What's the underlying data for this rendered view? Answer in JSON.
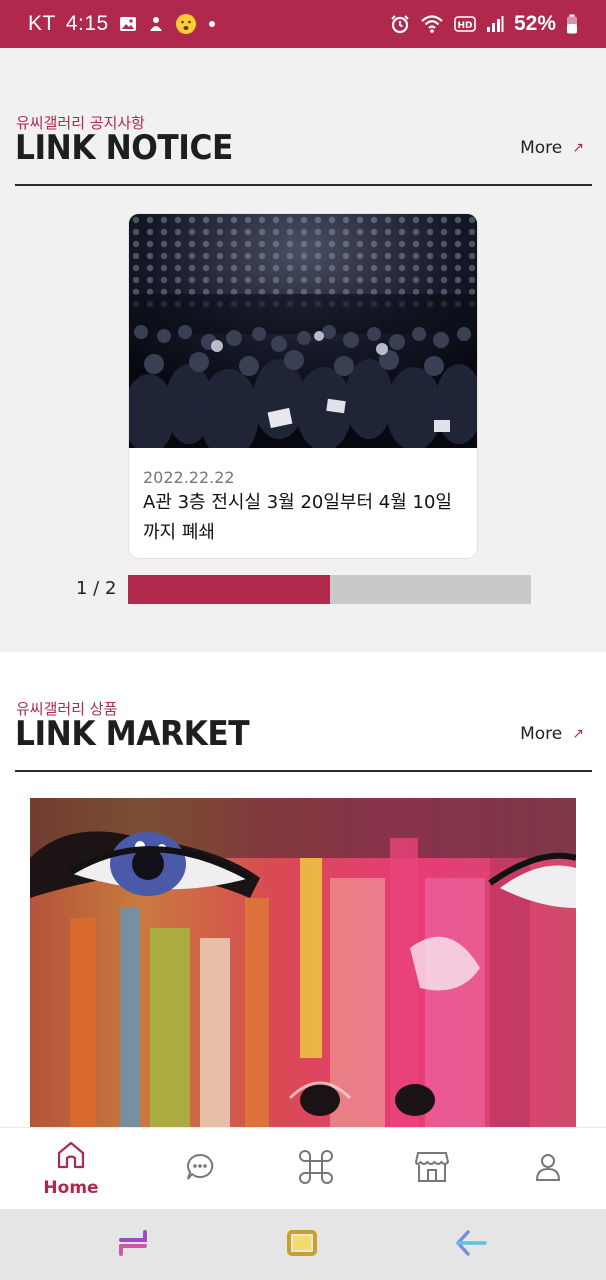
{
  "status_bar": {
    "carrier": "KT",
    "time": "4:15",
    "battery": "52%",
    "icons": [
      "gallery-icon",
      "bixby-icon",
      "emoji-icon",
      "dot-icon",
      "alarm-icon",
      "wifi-icon",
      "hd-icon",
      "signal-icon",
      "battery-icon"
    ]
  },
  "notice": {
    "subtitle": "유씨갤러리 공지사항",
    "title": "LINK NOTICE",
    "more_label": "More",
    "card": {
      "date": "2022.22.22",
      "title": "A관 3층 전시실 3월 20일부터 4월 10일까지 폐쇄"
    },
    "pager": {
      "text": "1 / 2",
      "current": 1,
      "total": 2
    }
  },
  "market": {
    "subtitle": "유씨갤러리 상품",
    "title": "LINK MARKET",
    "more_label": "More"
  },
  "bottom_nav": {
    "items": [
      {
        "icon": "home-icon",
        "label": "Home",
        "active": true
      },
      {
        "icon": "chat-icon",
        "label": ""
      },
      {
        "icon": "command-icon",
        "label": ""
      },
      {
        "icon": "store-icon",
        "label": ""
      },
      {
        "icon": "user-icon",
        "label": ""
      }
    ]
  },
  "system_nav": {
    "buttons": [
      "recents-icon",
      "home-square-icon",
      "back-arrow-icon"
    ]
  },
  "colors": {
    "accent": "#b0284b",
    "background": "#f1f1f1",
    "rule": "#2b2b2b",
    "pager_track": "#c9c9c9"
  }
}
